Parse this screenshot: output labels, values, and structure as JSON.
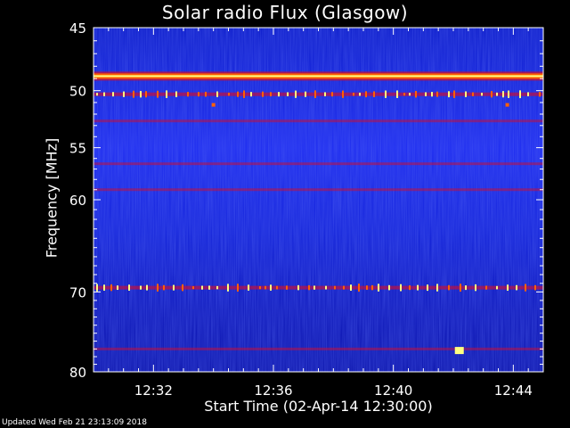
{
  "chart_data": {
    "type": "heatmap",
    "title": "Solar radio Flux (Glasgow)",
    "ylabel": "Frequency [MHz]",
    "xlabel": "Start Time (02-Apr-14 12:30:00)",
    "y_scale": "log",
    "ylim": [
      45,
      80
    ],
    "y_ticks": [
      45,
      50,
      55,
      60,
      70,
      80
    ],
    "x_range_minutes": [
      0,
      15
    ],
    "x_ticks": [
      {
        "minute": 2,
        "label": "12:32"
      },
      {
        "minute": 6,
        "label": "12:36"
      },
      {
        "minute": 10,
        "label": "12:40"
      },
      {
        "minute": 14,
        "label": "12:44"
      }
    ],
    "colormap": [
      "#0000a0",
      "#1010e0",
      "#3030ff",
      "#c01040",
      "#ff6000",
      "#ffff80"
    ],
    "features": [
      {
        "kind": "strong-band",
        "freq_mhz": 48.8
      },
      {
        "kind": "spiky-band",
        "freq_mhz": 50.3
      },
      {
        "kind": "dot",
        "minute": 4.0,
        "freq_mhz": 51.2
      },
      {
        "kind": "dot",
        "minute": 13.8,
        "freq_mhz": 51.2
      },
      {
        "kind": "weak-band",
        "freq_mhz": 52.6
      },
      {
        "kind": "weak-band",
        "freq_mhz": 56.5
      },
      {
        "kind": "weak-band",
        "freq_mhz": 59.0
      },
      {
        "kind": "spiky-band",
        "freq_mhz": 69.5
      },
      {
        "kind": "weak-band",
        "freq_mhz": 77.0
      },
      {
        "kind": "bright-spot",
        "minute": 12.2,
        "freq_mhz": 77.2
      }
    ]
  },
  "footer": {
    "updated": "Updated Wed Feb 21 23:13:09 2018"
  }
}
